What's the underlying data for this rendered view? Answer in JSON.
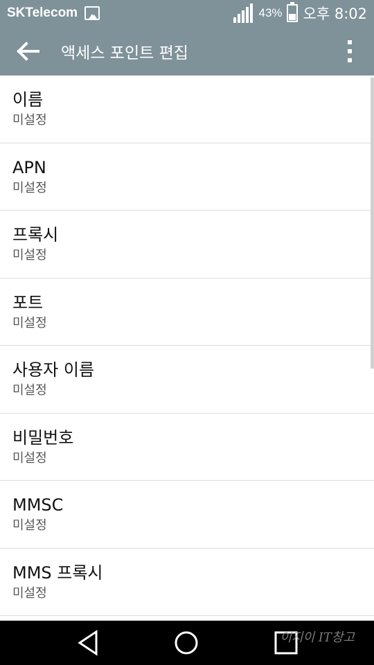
{
  "status_bar": {
    "carrier": "SKTelecom",
    "battery_percent": "43%",
    "time": "오후 8:02",
    "icons": [
      "gallery-icon",
      "signal-icon",
      "battery-icon"
    ]
  },
  "app_bar": {
    "title": "액세스 포인트 편집",
    "back_icon": "arrow-back-icon",
    "menu_icon": "more-vert-icon"
  },
  "apn_fields": [
    {
      "title": "이름",
      "value": "미설정"
    },
    {
      "title": "APN",
      "value": "미설정"
    },
    {
      "title": "프록시",
      "value": "미설정"
    },
    {
      "title": "포트",
      "value": "미설정"
    },
    {
      "title": "사용자 이름",
      "value": "미설정"
    },
    {
      "title": "비밀번호",
      "value": "미설정"
    },
    {
      "title": "MMSC",
      "value": "미설정"
    },
    {
      "title": "MMS 프록시",
      "value": "미설정"
    }
  ],
  "nav_bar": {
    "icons": [
      "nav-back-icon",
      "nav-home-icon",
      "nav-recent-icon"
    ],
    "watermark": "이지이 IT창고"
  },
  "colors": {
    "app_bar": "#7f9199",
    "nav_bar": "#000000",
    "divider": "#dcdcdc"
  }
}
